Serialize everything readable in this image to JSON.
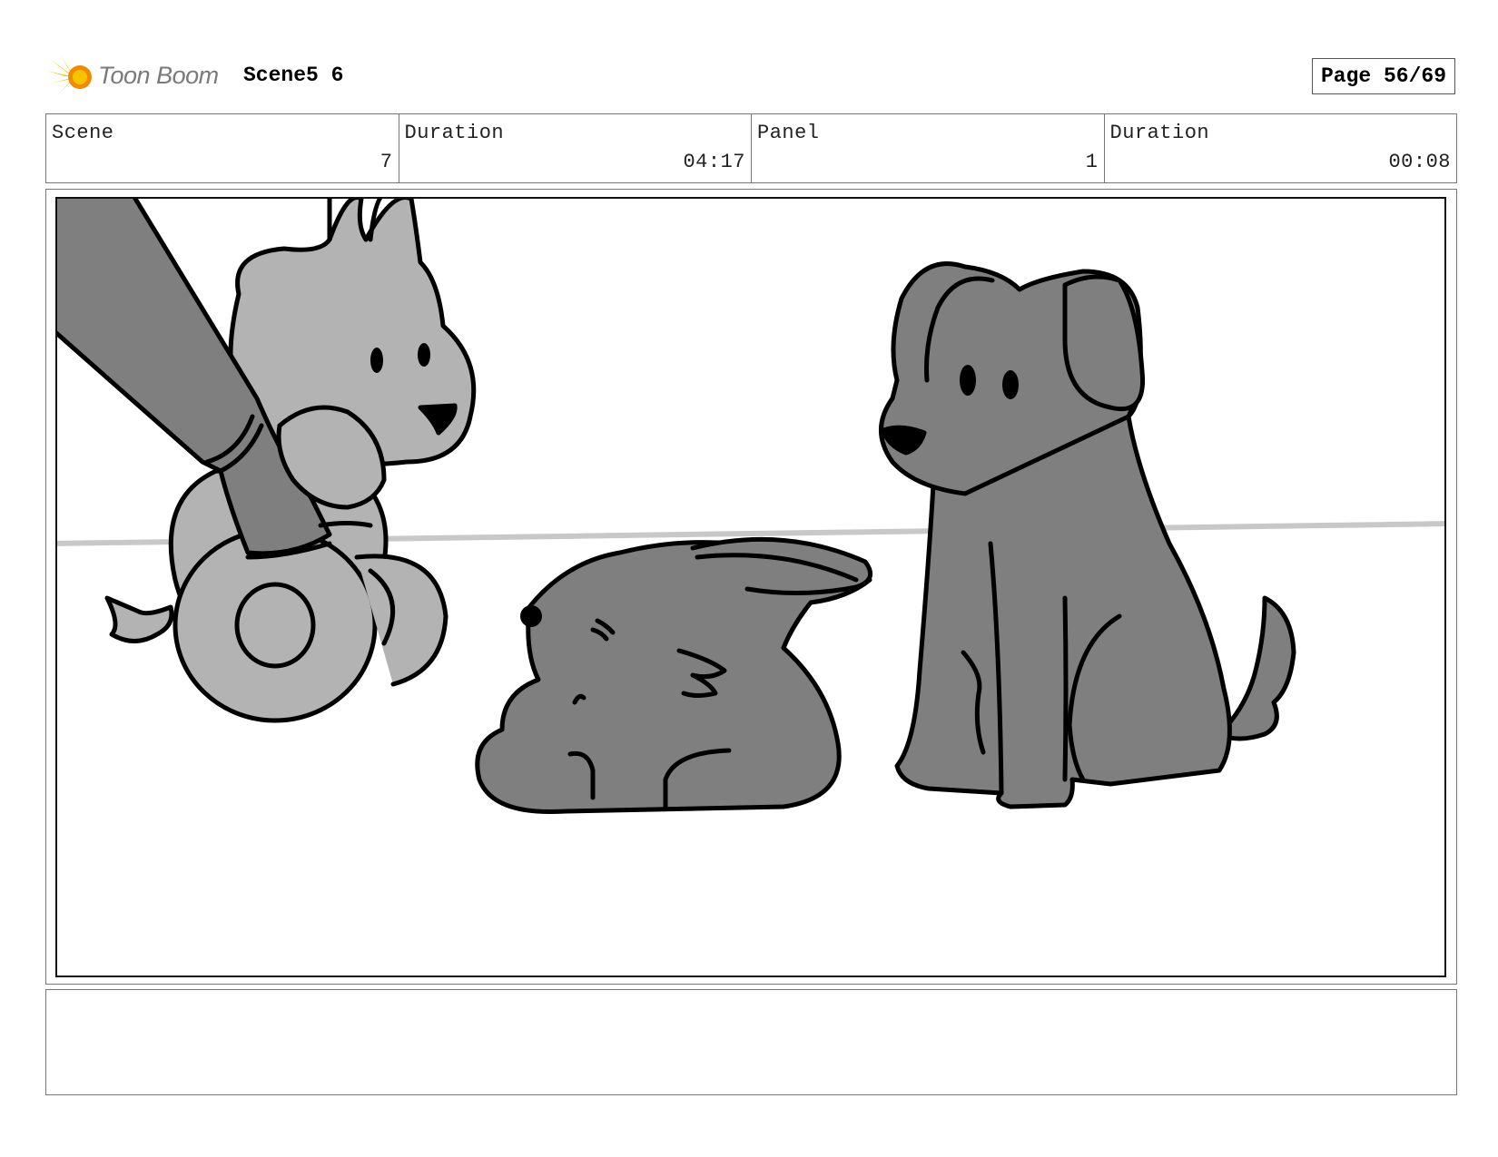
{
  "header": {
    "logo_text": "Toon Boom",
    "scene_title": "Scene5 6",
    "page_label": "Page 56/69"
  },
  "info": {
    "scene_label": "Scene",
    "scene_value": "7",
    "scene_duration_label": "Duration",
    "scene_duration_value": "04:17",
    "panel_label": "Panel",
    "panel_value": "1",
    "panel_duration_label": "Duration",
    "panel_duration_value": "00:08"
  },
  "colors": {
    "logo_yellow": "#f5c400",
    "logo_orange": "#f08a00",
    "light_gray": "#b3b3b3",
    "dark_gray": "#7f7f7f",
    "outline": "#000000"
  },
  "panel": {
    "characters": [
      "puppy-toy-held-by-arm",
      "lying-puppy",
      "sitting-dog"
    ]
  },
  "notes": {
    "text": ""
  }
}
